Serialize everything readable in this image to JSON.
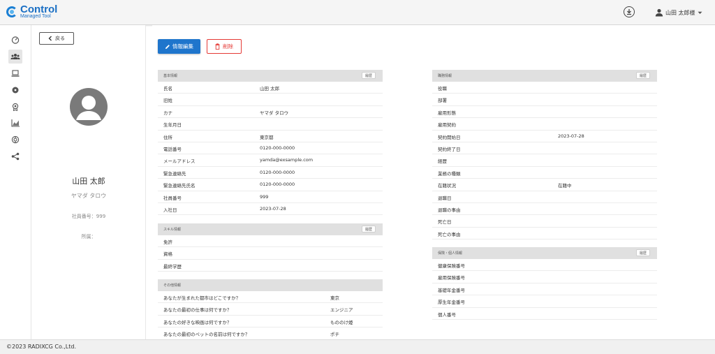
{
  "header": {
    "brand_title": "Control",
    "brand_subtitle": "Managed Tool",
    "user_name": "山田 太郎様",
    "icons": {
      "download": "download-circle-icon",
      "user": "person-icon",
      "caret": "caret-down-icon"
    }
  },
  "rail": {
    "items": [
      {
        "icon": "speedometer-icon"
      },
      {
        "icon": "users-group-icon",
        "active": true
      },
      {
        "icon": "laptop-icon"
      },
      {
        "icon": "disc-icon"
      },
      {
        "icon": "award-badge-icon"
      },
      {
        "icon": "area-chart-icon"
      },
      {
        "icon": "support-lifebuoy-icon"
      },
      {
        "icon": "share-icon"
      }
    ]
  },
  "profile": {
    "back_label": "戻る",
    "name": "山田 太郎",
    "kana": "ヤマダ タロウ",
    "employee_no": "社員番号：999",
    "department": "所属："
  },
  "actions": {
    "edit_label": "情報編集",
    "delete_label": "削除"
  },
  "sections": {
    "basic": {
      "title": "基本情報",
      "button": "履歴",
      "rows": [
        {
          "label": "氏名",
          "value": "山田 太郎"
        },
        {
          "label": "旧姓",
          "value": ""
        },
        {
          "label": "カナ",
          "value": "ヤマダ タロウ"
        },
        {
          "label": "生年月日",
          "value": ""
        },
        {
          "label": "住所",
          "value": "東京都"
        },
        {
          "label": "電話番号",
          "value": "0120-000-0000"
        },
        {
          "label": "メールアドレス",
          "value": "yamda@exsample.com"
        },
        {
          "label": "緊急連絡先",
          "value": "0120-000-0000"
        },
        {
          "label": "緊急連絡先氏名",
          "value": "0120-000-0000"
        },
        {
          "label": "社員番号",
          "value": "999"
        },
        {
          "label": "入社日",
          "value": "2023-07-28"
        }
      ]
    },
    "skill": {
      "title": "スキル情報",
      "button": "履歴",
      "rows": [
        {
          "label": "免許",
          "value": ""
        },
        {
          "label": "資格",
          "value": ""
        },
        {
          "label": "最終学歴",
          "value": ""
        }
      ]
    },
    "other": {
      "title": "その他情報",
      "rows": [
        {
          "label": "あなたが生まれた都市はどこですか？",
          "value": "東京"
        },
        {
          "label": "あなたの最初の仕事は何ですか？",
          "value": "エンジニア"
        },
        {
          "label": "あなたの好きな映画は何ですか？",
          "value": "もののけ姫"
        },
        {
          "label": "あなたの最初のペットの名前は何ですか？",
          "value": "ポチ"
        }
      ]
    },
    "job": {
      "title": "職務情報",
      "button": "履歴",
      "rows": [
        {
          "label": "役職",
          "value": ""
        },
        {
          "label": "部署",
          "value": ""
        },
        {
          "label": "雇用形態",
          "value": ""
        },
        {
          "label": "雇用契約",
          "value": ""
        },
        {
          "label": "契約開始日",
          "value": "2023-07-28"
        },
        {
          "label": "契約終了日",
          "value": ""
        },
        {
          "label": "経歴",
          "value": ""
        },
        {
          "label": "業務の種類",
          "value": ""
        },
        {
          "label": "在籍状況",
          "value": "在籍中"
        },
        {
          "label": "退職日",
          "value": ""
        },
        {
          "label": "退職の事由",
          "value": ""
        },
        {
          "label": "死亡日",
          "value": ""
        },
        {
          "label": "死亡の事由",
          "value": ""
        }
      ]
    },
    "insurance": {
      "title": "保険・個人情報",
      "button": "履歴",
      "rows": [
        {
          "label": "健康保険番号",
          "value": ""
        },
        {
          "label": "雇用保険番号",
          "value": ""
        },
        {
          "label": "基礎年金番号",
          "value": ""
        },
        {
          "label": "厚生年金番号",
          "value": ""
        },
        {
          "label": "個人番号",
          "value": ""
        }
      ]
    }
  },
  "footer": {
    "copyright": "©2023 RADIXCG Co.,Ltd."
  },
  "colors": {
    "primary": "#1f75cc",
    "danger": "#e53935",
    "brand": "#1a6fc4",
    "avatar": "#7a7a7a"
  }
}
